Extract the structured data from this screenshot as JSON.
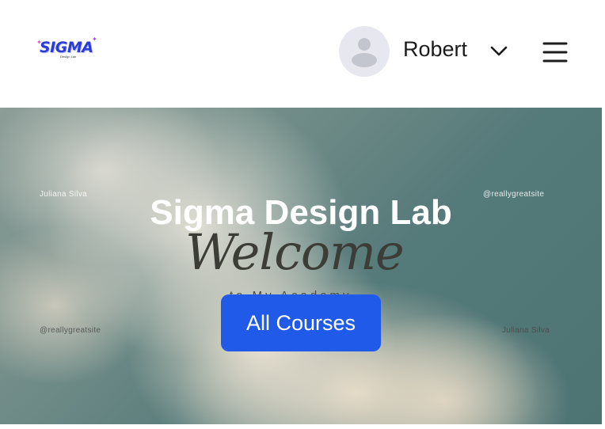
{
  "header": {
    "logo": {
      "text": "SIGMA",
      "subtext": "Design Lab",
      "brand_color": "#2a3bd8",
      "accent_color": "#e84ad9"
    },
    "user": {
      "name": "Robert",
      "avatar_icon": "user-silhouette-icon",
      "dropdown_icon": "chevron-down-icon"
    },
    "menu_icon": "hamburger-menu-icon"
  },
  "hero": {
    "title": "Sigma Design Lab",
    "cta_label": "All Courses",
    "cta_color": "#1f5ae8",
    "background_image": {
      "labels": {
        "top_left": "Juliana Silva",
        "top_right": "@reallygreatsite",
        "bottom_left": "@reallygreatsite",
        "bottom_right": "Juliana Silva"
      },
      "script_text": "Welcome",
      "subtitle": "to My Academy"
    }
  }
}
